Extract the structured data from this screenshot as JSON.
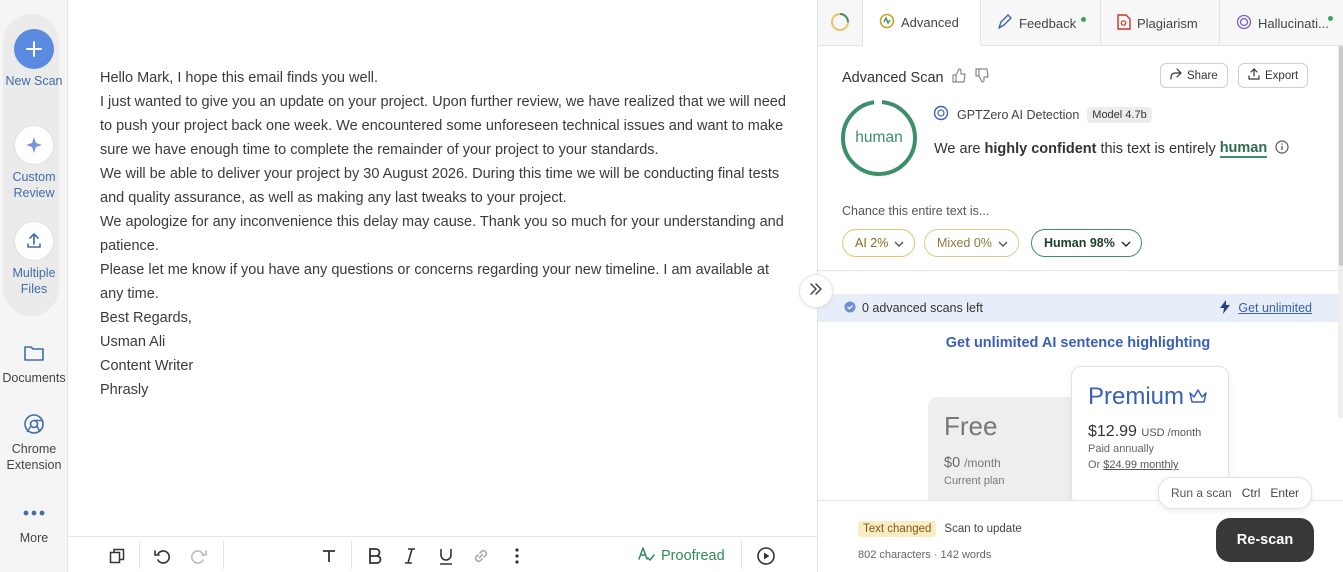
{
  "rail": {
    "new_scan": "New Scan",
    "custom_review": "Custom Review",
    "multiple_files": "Multiple Files",
    "documents": "Documents",
    "chrome_extension": "Chrome Extension",
    "more": "More"
  },
  "editor": {
    "paragraphs": [
      "Hello Mark, I hope this email finds you well.",
      "I just wanted to give you an update on your project. Upon further review, we have realized that we will need to push your project back one week. We encountered some unforeseen technical issues and want to make sure we have enough time to complete the remainder of your project to your standards.",
      "We will be able to deliver your project by 30 August 2026. During this time we will be conducting final tests and quality assurance, as well as making any last tweaks to your project.",
      "We apologize for any inconvenience this delay may cause. Thank you so much for your understanding and patience.",
      "Please let me know if you have any questions or concerns regarding your new timeline. I am available at any time.",
      "Best Regards,",
      "Usman Ali",
      "Content Writer",
      "Phrasly"
    ],
    "proofread_label": "Proofread"
  },
  "tabs": {
    "advanced": "Advanced",
    "feedback": "Feedback",
    "plagiarism": "Plagiarism",
    "hallucination": "Hallucinati..."
  },
  "scan": {
    "title": "Advanced Scan",
    "share": "Share",
    "export": "Export",
    "ring_label": "human",
    "detector": "GPTZero AI Detection",
    "model": "Model 4.7b",
    "verdict_prefix": "We are",
    "verdict_conf": "highly confident",
    "verdict_mid": "this text is entirely",
    "verdict_word": "human",
    "chance_label": "Chance this entire text is...",
    "ai_pill": "AI 2%",
    "mixed_pill": "Mixed 0%",
    "human_pill": "Human 98%"
  },
  "promo": {
    "scans_left": "0 advanced scans left",
    "get_unlimited": "Get unlimited",
    "headline": "Get unlimited AI sentence highlighting",
    "free": {
      "name": "Free",
      "price": "$0",
      "period": "/month",
      "note": "Current plan"
    },
    "premium": {
      "name": "Premium",
      "price": "$12.99",
      "period": "USD /month",
      "billing": "Paid annually",
      "or": "Or",
      "monthly": "$24.99 monthly"
    }
  },
  "hint": {
    "run": "Run a scan",
    "ctrl": "Ctrl",
    "enter": "Enter"
  },
  "bottom": {
    "changed_tag": "Text changed",
    "scan_update": "Scan to update",
    "counts": "802 characters · 142 words",
    "rescan": "Re-scan"
  },
  "colors": {
    "accent_green": "#3d8f68",
    "brand_blue": "#3a5fb8",
    "ai_yellow": "#e9c46a"
  }
}
